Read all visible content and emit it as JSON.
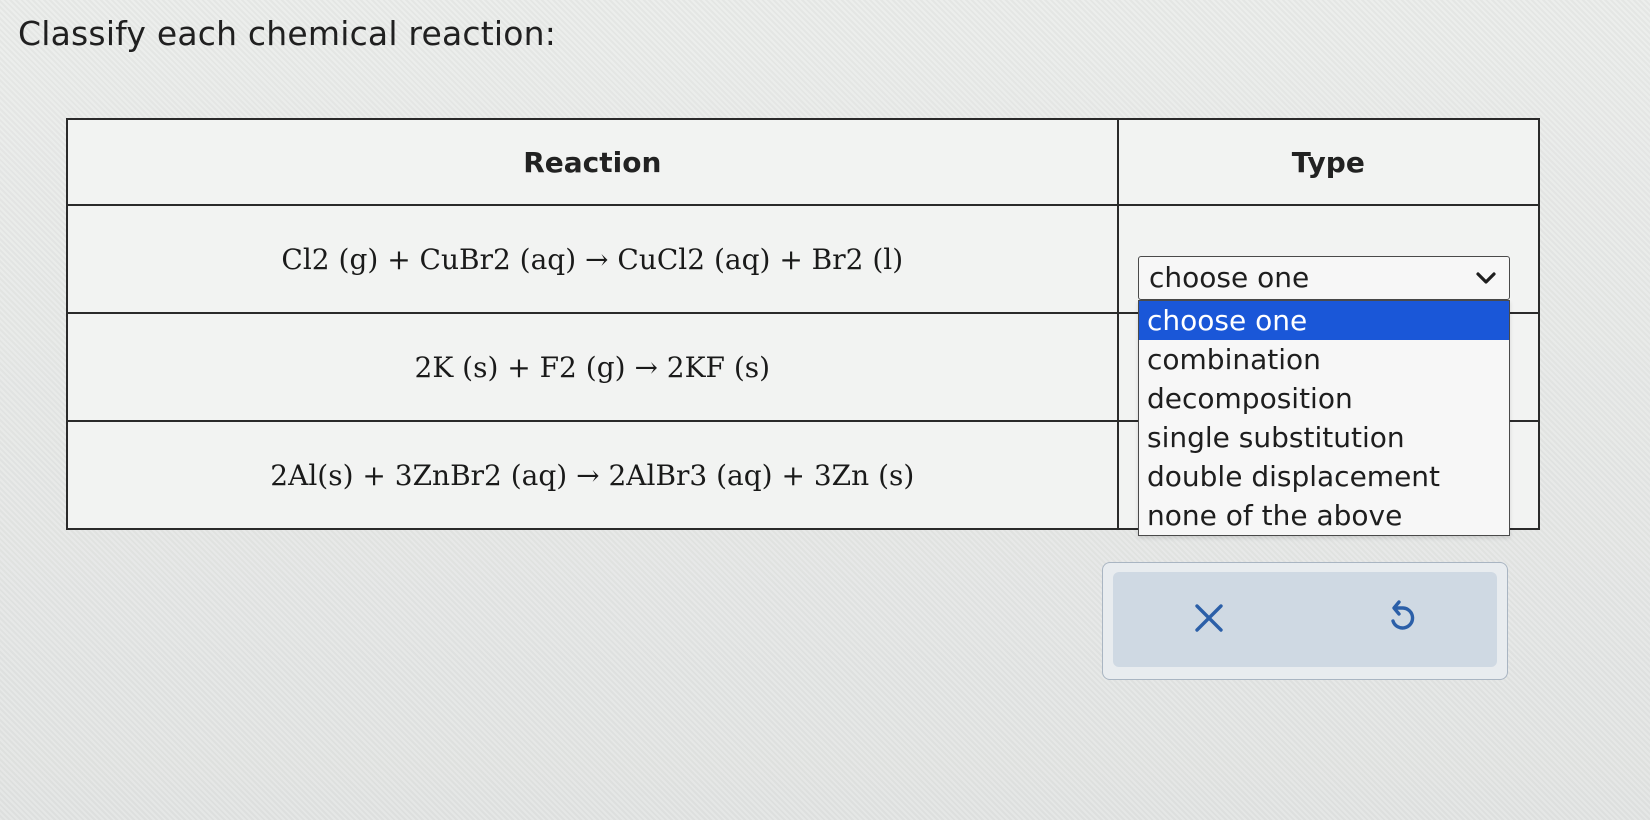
{
  "prompt": "Classify each chemical reaction:",
  "table": {
    "headers": {
      "reaction": "Reaction",
      "type": "Type"
    },
    "rows": [
      {
        "equation": "Cl2 (g) + CuBr2 (aq) → CuCl2 (aq) + Br2 (l)"
      },
      {
        "equation": "2K (s) + F2 (g) → 2KF (s)"
      },
      {
        "equation": "2Al(s) + 3ZnBr2 (aq) → 2AlBr3 (aq) + 3Zn (s)"
      }
    ]
  },
  "dropdown": {
    "selected": "choose one",
    "icon": "chevron-down-icon",
    "options": [
      "choose one",
      "combination",
      "decomposition",
      "single substitution",
      "double displacement",
      "none of the above"
    ],
    "highlighted_index": 0,
    "highlight_color": "#1a57d8"
  },
  "actions": {
    "clear_icon": "x-icon",
    "undo_icon": "undo-icon",
    "icon_color": "#2b5fa8"
  }
}
